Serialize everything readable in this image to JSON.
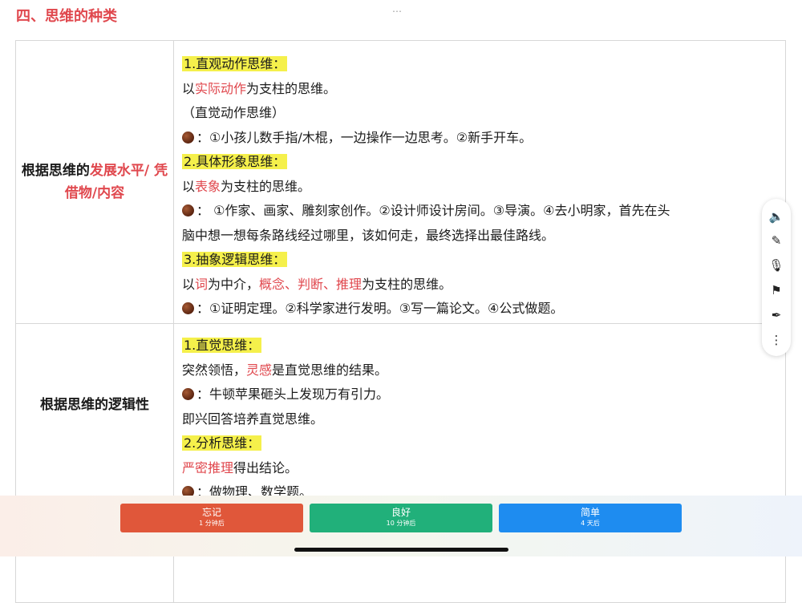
{
  "page": {
    "title": "四、思维的种类",
    "more_icon": "⋯"
  },
  "rows": [
    {
      "label_a": "根据思维的",
      "label_b": "发展水平/ 凭借物/内容",
      "lines": [
        {
          "hl": "1.直观动作思维："
        },
        {
          "pre": "以",
          "red": "实际动作",
          "post": "为支柱的思维。"
        },
        {
          "pre": "（直觉动作思维）"
        },
        {
          "icon": true,
          "pre": "：①小孩儿数手指/木棍，一边操作一边思考。②新手开车。"
        },
        {
          "hl": "2.具体形象思维："
        },
        {
          "pre": "以",
          "red": "表象",
          "post": "为支柱的思维。"
        },
        {
          "icon": true,
          "pre": "： ①作家、画家、雕刻家创作。②设计师设计房间。③导演。④去小明家，首先在头"
        },
        {
          "pre": "脑中想一想每条路线经过哪里，该如何走，最终选择出最佳路线。"
        },
        {
          "hl": "3.抽象逻辑思维："
        },
        {
          "pre": "以",
          "red": "词",
          "mid": "为中介，",
          "red2": "概念、判断、推理",
          "post": "为支柱的思维。"
        },
        {
          "icon": true,
          "pre": "：①证明定理。②科学家进行发明。③写一篇论文。④公式做题。"
        }
      ]
    },
    {
      "label_a": "根据思维的逻辑性",
      "label_b": "",
      "lines": [
        {
          "hl": "1.直觉思维："
        },
        {
          "pre": "突然领悟，",
          "red": "灵感",
          "post": "是直觉思维的结果。"
        },
        {
          "icon": true,
          "pre": "：牛顿苹果砸头上发现万有引力。"
        },
        {
          "pre": "即兴回答培养直觉思维。"
        },
        {
          "hl": "2.分析思维："
        },
        {
          "red": "严密推理",
          "post": "得出结论。"
        },
        {
          "icon": true,
          "pre": "：做物理、数学题。"
        }
      ]
    }
  ],
  "toolbar": {
    "icons": [
      "speaker-icon",
      "pencil-icon",
      "microphone-icon",
      "flag-icon",
      "pen-icon",
      "more-icon"
    ],
    "glyphs": [
      "🔈",
      "✎",
      "🎙",
      "⚑",
      "✒",
      "⋮"
    ]
  },
  "buttons": [
    {
      "label": "忘记",
      "sub": "1 分钟后",
      "color": "#e0573a"
    },
    {
      "label": "良好",
      "sub": "10 分钟后",
      "color": "#21b07a"
    },
    {
      "label": "简单",
      "sub": "4 天后",
      "color": "#1e8cf0"
    }
  ]
}
